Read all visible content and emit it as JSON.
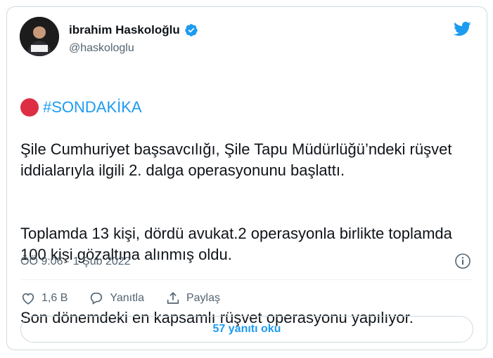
{
  "author": {
    "name": "ibrahim Haskoloğlu",
    "handle": "@haskologlu"
  },
  "tweet": {
    "hashtag": "#SONDAKİKA",
    "paragraphs": [
      "Şile Cumhuriyet başsavcılığı, Şile Tapu Müdürlüğü’ndeki rüşvet iddialarıyla ilgili 2. dalga operasyonunu başlattı.",
      "Toplamda 13 kişi, dördü avukat.2 operasyonla birlikte toplamda 100 kişi gözaltına alınmış oldu.",
      "Son dönemdeki en kapsamlı rüşvet operasyonu yapılıyor."
    ],
    "timestamp": "ÖÖ 9:06 · 1 Şub 2022"
  },
  "actions": {
    "like_count": "1,6 B",
    "reply_label": "Yanıtla",
    "share_label": "Paylaş"
  },
  "replies_button": "57 yanıtı oku",
  "colors": {
    "accent": "#1d9bf0",
    "text": "#0f1419",
    "muted": "#536471",
    "red_circle": "#dd2e44"
  },
  "icons": [
    "verified-badge-icon",
    "twitter-bird-icon",
    "red-circle-emoji",
    "info-icon",
    "heart-icon",
    "reply-bubble-icon",
    "share-icon"
  ]
}
